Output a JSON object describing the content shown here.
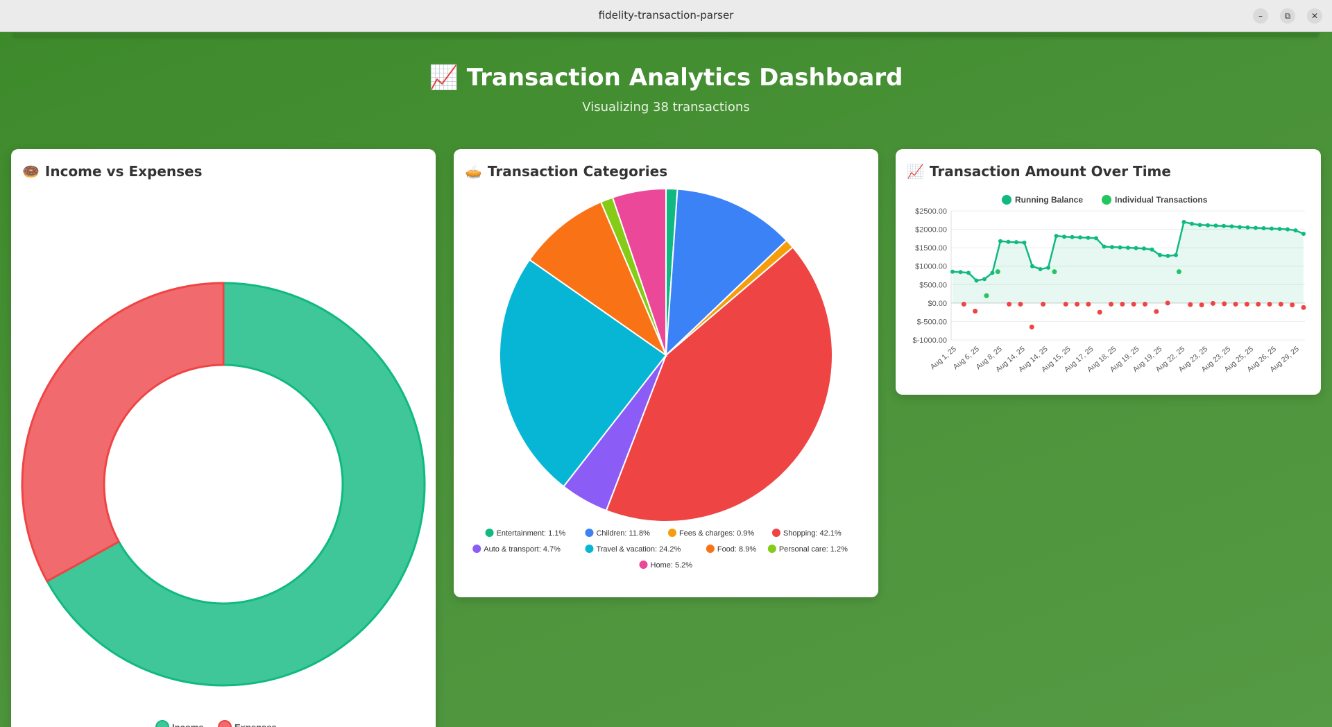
{
  "window": {
    "title": "fidelity-transaction-parser",
    "minimize": "–",
    "restore": "⧉",
    "close": "✕"
  },
  "header": {
    "title_icon": "📈",
    "title": "Transaction Analytics Dashboard",
    "subtitle": "Visualizing 38 transactions"
  },
  "cards": {
    "income": {
      "icon": "🍩",
      "title": "Income vs Expenses"
    },
    "categories": {
      "icon": "🥧",
      "title": "Transaction Categories"
    },
    "time": {
      "icon": "📈",
      "title": "Transaction Amount Over Time"
    }
  },
  "chart_data": [
    {
      "type": "pie",
      "variant": "doughnut",
      "categories": [
        "Income",
        "Expenses"
      ],
      "values": [
        67,
        33
      ],
      "colors": [
        "#3fc79a",
        "#f16b6e"
      ],
      "border_colors": [
        "#10b981",
        "#ef4444"
      ],
      "legend": "bottom"
    },
    {
      "type": "pie",
      "categories": [
        "Entertainment: 1.1%",
        "Children: 11.8%",
        "Fees & charges: 0.9%",
        "Shopping: 42.1%",
        "Auto & transport: 4.7%",
        "Travel & vacation: 24.2%",
        "Food: 8.9%",
        "Personal care: 1.2%",
        "Home: 5.2%"
      ],
      "values": [
        1.1,
        11.8,
        0.9,
        42.1,
        4.7,
        24.2,
        8.9,
        1.2,
        5.2
      ],
      "colors": [
        "#10b981",
        "#3b82f6",
        "#f59e0b",
        "#ef4444",
        "#8b5cf6",
        "#06b6d4",
        "#f97316",
        "#84cc16",
        "#ec4899"
      ],
      "legend": "bottom"
    },
    {
      "type": "line",
      "legend": "top",
      "ylim": [
        -1000,
        2500
      ],
      "yticks": [
        2500,
        2000,
        1500,
        1000,
        500,
        0,
        -500,
        -1000
      ],
      "ytick_labels": [
        "$2500.00",
        "$2000.00",
        "$1500.00",
        "$1000.00",
        "$500.00",
        "$0.00",
        "$-500.00",
        "$-1000.00"
      ],
      "xtick_labels": [
        "Aug 1, 25",
        "Aug 6, 25",
        "Aug 8, 25",
        "Aug 14, 25",
        "Aug 14, 25",
        "Aug 15, 25",
        "Aug 17, 25",
        "Aug 18, 25",
        "Aug 19, 25",
        "Aug 19, 25",
        "Aug 22, 25",
        "Aug 23, 25",
        "Aug 23, 25",
        "Aug 25, 25",
        "Aug 26, 25",
        "Aug 29, 25"
      ],
      "series": [
        {
          "name": "Running Balance",
          "color": "#10b981",
          "fill": "rgba(16,185,129,0.1)",
          "values": [
            850,
            840,
            820,
            610,
            650,
            820,
            1680,
            1660,
            1650,
            1640,
            1000,
            920,
            960,
            1820,
            1800,
            1790,
            1780,
            1770,
            1760,
            1530,
            1520,
            1510,
            1500,
            1490,
            1480,
            1450,
            1300,
            1280,
            1300,
            2200,
            2150,
            2120,
            2110,
            2100,
            2090,
            2080,
            2060,
            2050,
            2040,
            2030,
            2020,
            2010,
            2000,
            1970,
            1880
          ]
        },
        {
          "name": "Individual Transactions",
          "color": "#22c55e",
          "negative_color": "#ef4444",
          "values": [
            null,
            -30,
            -220,
            200,
            850,
            -30,
            -30,
            -650,
            -30,
            850,
            -30,
            -30,
            -30,
            -250,
            -30,
            -30,
            -30,
            -30,
            -230,
            0,
            850,
            -40,
            -50,
            -10,
            -20,
            -30,
            -30,
            -30,
            -30,
            -30,
            -50,
            -120
          ]
        }
      ]
    }
  ]
}
